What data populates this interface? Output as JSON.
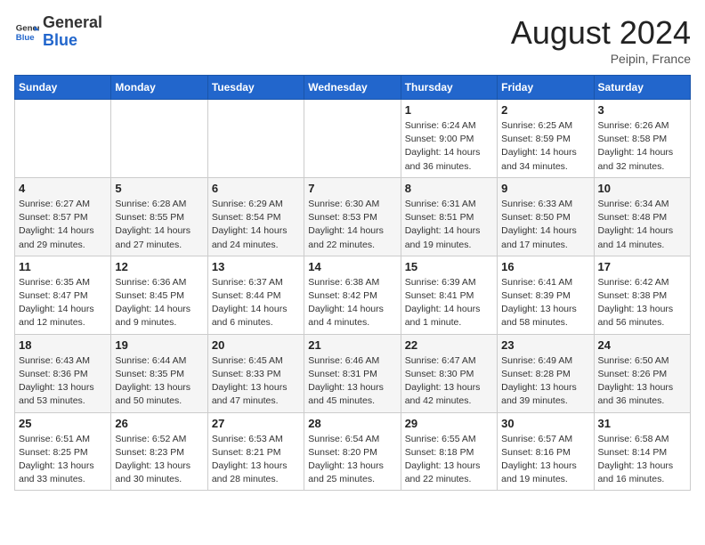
{
  "header": {
    "logo_general": "General",
    "logo_blue": "Blue",
    "month_year": "August 2024",
    "location": "Peipin, France"
  },
  "weekdays": [
    "Sunday",
    "Monday",
    "Tuesday",
    "Wednesday",
    "Thursday",
    "Friday",
    "Saturday"
  ],
  "weeks": [
    [
      {
        "day": "",
        "info": ""
      },
      {
        "day": "",
        "info": ""
      },
      {
        "day": "",
        "info": ""
      },
      {
        "day": "",
        "info": ""
      },
      {
        "day": "1",
        "info": "Sunrise: 6:24 AM\nSunset: 9:00 PM\nDaylight: 14 hours\nand 36 minutes."
      },
      {
        "day": "2",
        "info": "Sunrise: 6:25 AM\nSunset: 8:59 PM\nDaylight: 14 hours\nand 34 minutes."
      },
      {
        "day": "3",
        "info": "Sunrise: 6:26 AM\nSunset: 8:58 PM\nDaylight: 14 hours\nand 32 minutes."
      }
    ],
    [
      {
        "day": "4",
        "info": "Sunrise: 6:27 AM\nSunset: 8:57 PM\nDaylight: 14 hours\nand 29 minutes."
      },
      {
        "day": "5",
        "info": "Sunrise: 6:28 AM\nSunset: 8:55 PM\nDaylight: 14 hours\nand 27 minutes."
      },
      {
        "day": "6",
        "info": "Sunrise: 6:29 AM\nSunset: 8:54 PM\nDaylight: 14 hours\nand 24 minutes."
      },
      {
        "day": "7",
        "info": "Sunrise: 6:30 AM\nSunset: 8:53 PM\nDaylight: 14 hours\nand 22 minutes."
      },
      {
        "day": "8",
        "info": "Sunrise: 6:31 AM\nSunset: 8:51 PM\nDaylight: 14 hours\nand 19 minutes."
      },
      {
        "day": "9",
        "info": "Sunrise: 6:33 AM\nSunset: 8:50 PM\nDaylight: 14 hours\nand 17 minutes."
      },
      {
        "day": "10",
        "info": "Sunrise: 6:34 AM\nSunset: 8:48 PM\nDaylight: 14 hours\nand 14 minutes."
      }
    ],
    [
      {
        "day": "11",
        "info": "Sunrise: 6:35 AM\nSunset: 8:47 PM\nDaylight: 14 hours\nand 12 minutes."
      },
      {
        "day": "12",
        "info": "Sunrise: 6:36 AM\nSunset: 8:45 PM\nDaylight: 14 hours\nand 9 minutes."
      },
      {
        "day": "13",
        "info": "Sunrise: 6:37 AM\nSunset: 8:44 PM\nDaylight: 14 hours\nand 6 minutes."
      },
      {
        "day": "14",
        "info": "Sunrise: 6:38 AM\nSunset: 8:42 PM\nDaylight: 14 hours\nand 4 minutes."
      },
      {
        "day": "15",
        "info": "Sunrise: 6:39 AM\nSunset: 8:41 PM\nDaylight: 14 hours\nand 1 minute."
      },
      {
        "day": "16",
        "info": "Sunrise: 6:41 AM\nSunset: 8:39 PM\nDaylight: 13 hours\nand 58 minutes."
      },
      {
        "day": "17",
        "info": "Sunrise: 6:42 AM\nSunset: 8:38 PM\nDaylight: 13 hours\nand 56 minutes."
      }
    ],
    [
      {
        "day": "18",
        "info": "Sunrise: 6:43 AM\nSunset: 8:36 PM\nDaylight: 13 hours\nand 53 minutes."
      },
      {
        "day": "19",
        "info": "Sunrise: 6:44 AM\nSunset: 8:35 PM\nDaylight: 13 hours\nand 50 minutes."
      },
      {
        "day": "20",
        "info": "Sunrise: 6:45 AM\nSunset: 8:33 PM\nDaylight: 13 hours\nand 47 minutes."
      },
      {
        "day": "21",
        "info": "Sunrise: 6:46 AM\nSunset: 8:31 PM\nDaylight: 13 hours\nand 45 minutes."
      },
      {
        "day": "22",
        "info": "Sunrise: 6:47 AM\nSunset: 8:30 PM\nDaylight: 13 hours\nand 42 minutes."
      },
      {
        "day": "23",
        "info": "Sunrise: 6:49 AM\nSunset: 8:28 PM\nDaylight: 13 hours\nand 39 minutes."
      },
      {
        "day": "24",
        "info": "Sunrise: 6:50 AM\nSunset: 8:26 PM\nDaylight: 13 hours\nand 36 minutes."
      }
    ],
    [
      {
        "day": "25",
        "info": "Sunrise: 6:51 AM\nSunset: 8:25 PM\nDaylight: 13 hours\nand 33 minutes."
      },
      {
        "day": "26",
        "info": "Sunrise: 6:52 AM\nSunset: 8:23 PM\nDaylight: 13 hours\nand 30 minutes."
      },
      {
        "day": "27",
        "info": "Sunrise: 6:53 AM\nSunset: 8:21 PM\nDaylight: 13 hours\nand 28 minutes."
      },
      {
        "day": "28",
        "info": "Sunrise: 6:54 AM\nSunset: 8:20 PM\nDaylight: 13 hours\nand 25 minutes."
      },
      {
        "day": "29",
        "info": "Sunrise: 6:55 AM\nSunset: 8:18 PM\nDaylight: 13 hours\nand 22 minutes."
      },
      {
        "day": "30",
        "info": "Sunrise: 6:57 AM\nSunset: 8:16 PM\nDaylight: 13 hours\nand 19 minutes."
      },
      {
        "day": "31",
        "info": "Sunrise: 6:58 AM\nSunset: 8:14 PM\nDaylight: 13 hours\nand 16 minutes."
      }
    ]
  ]
}
